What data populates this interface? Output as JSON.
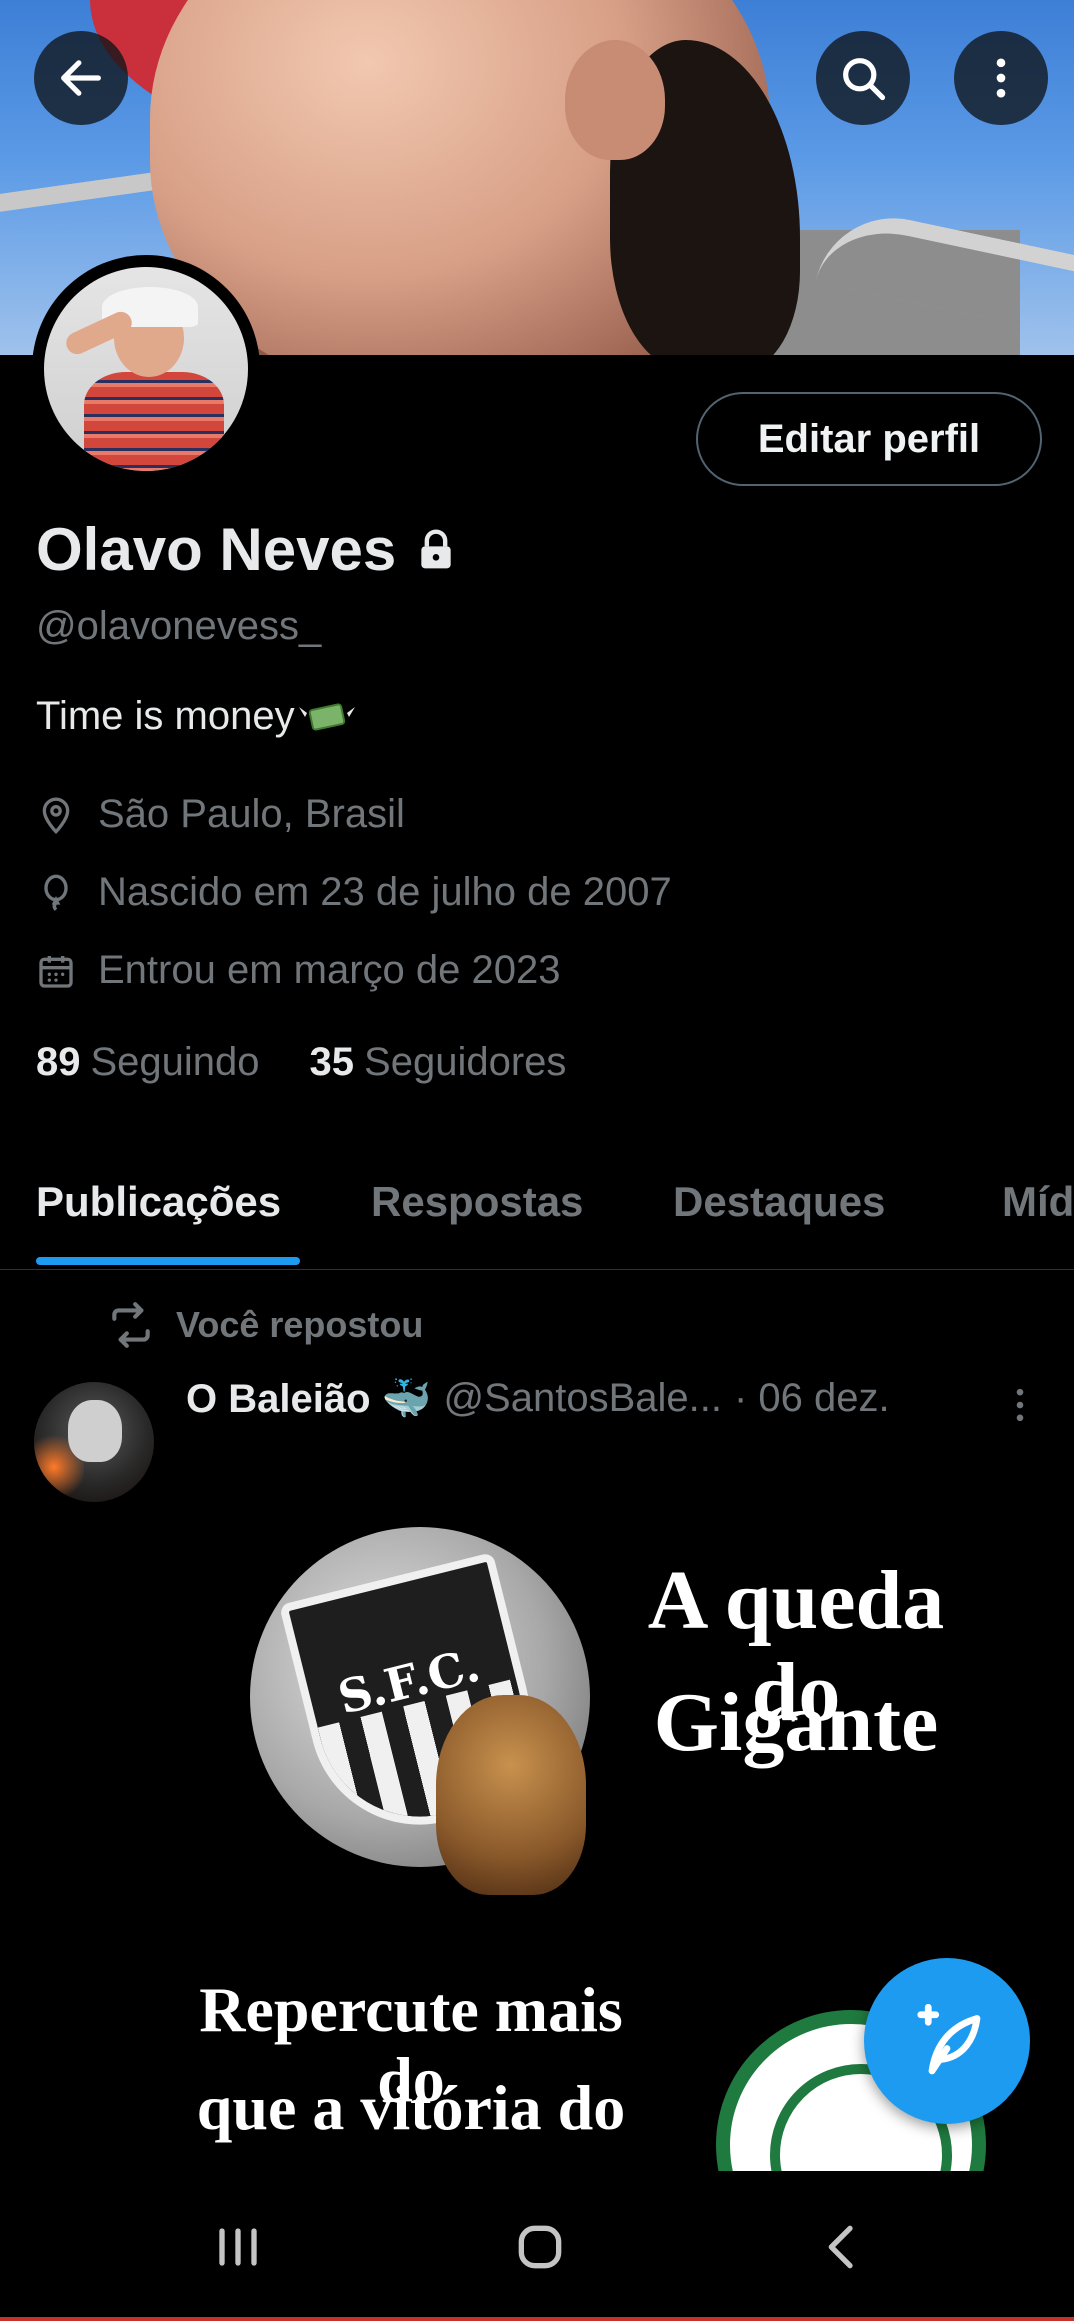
{
  "header": {
    "back_icon": "arrow-left-icon",
    "search_icon": "search-icon",
    "more_icon": "more-vertical-icon"
  },
  "profile": {
    "name": "Olavo Neves",
    "protected_icon": "lock-icon",
    "handle": "@olavonevess_",
    "bio": "Time is money",
    "bio_emoji": "money-with-wings-emoji",
    "location": "São Paulo, Brasil",
    "birth": "Nascido em 23 de julho de 2007",
    "joined": "Entrou em março de 2023",
    "following_count": "89",
    "following_label": "Seguindo",
    "followers_count": "35",
    "followers_label": "Seguidores",
    "edit_button": "Editar perfil"
  },
  "tabs": [
    {
      "label": "Publicações",
      "active": true
    },
    {
      "label": "Respostas",
      "active": false
    },
    {
      "label": "Destaques",
      "active": false
    },
    {
      "label": "Mídia",
      "active": false
    }
  ],
  "post": {
    "repost_label": "Você repostou",
    "author_name": "O Baleião 🐳",
    "author_handle": "@SantosBale...",
    "date": "· 06 dez.",
    "image_text": {
      "line1": "A queda do",
      "line2": "Gigante",
      "line3": "Repercute mais do",
      "line4": "que a vitória do"
    }
  },
  "colors": {
    "accent": "#1d9bf0",
    "background": "#000000",
    "secondary_text": "#71767b",
    "primary_text": "#e7e9ea"
  }
}
